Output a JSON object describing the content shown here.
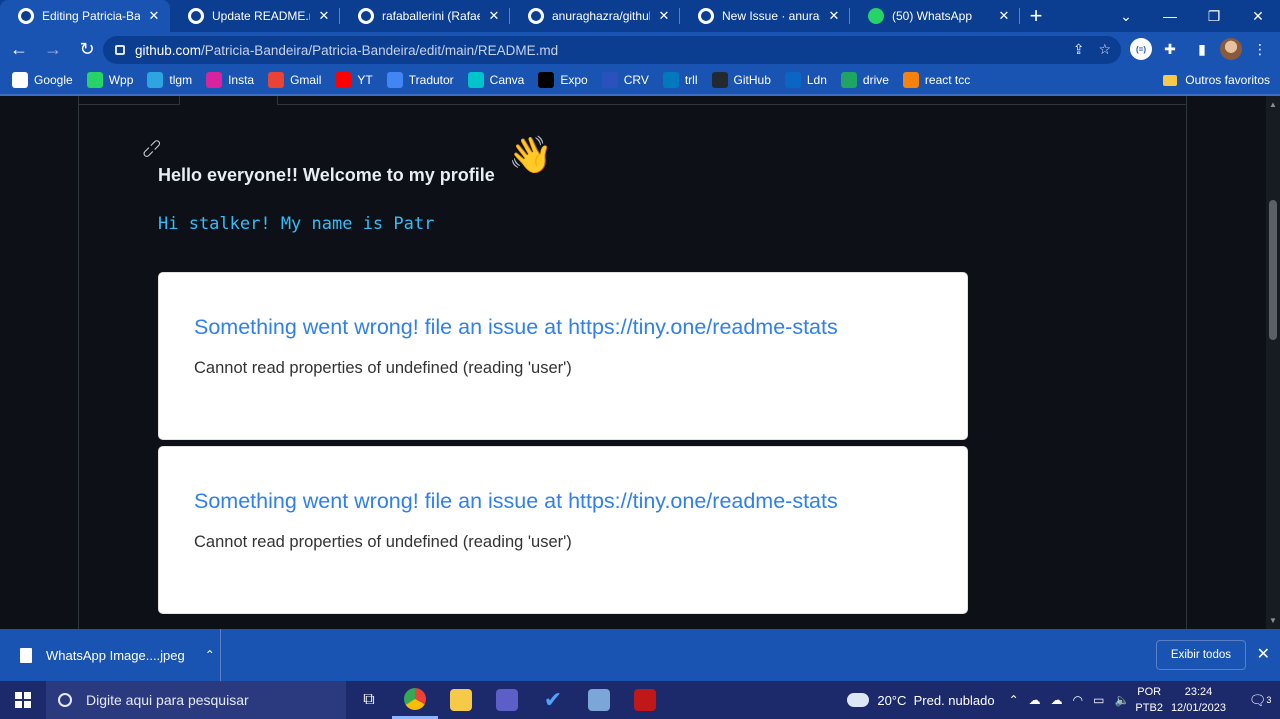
{
  "tabs": [
    {
      "title": "Editing Patricia-Bande",
      "favicon": "github-icon",
      "active": true
    },
    {
      "title": "Update README.md ·",
      "favicon": "github-icon",
      "active": false
    },
    {
      "title": "rafaballerini (Rafaella",
      "favicon": "github-icon",
      "active": false
    },
    {
      "title": "anuraghazra/github-re",
      "favicon": "github-icon",
      "active": false
    },
    {
      "title": "New Issue · anuraghaz",
      "favicon": "github-icon",
      "active": false
    },
    {
      "title": "(50) WhatsApp",
      "favicon": "whatsapp-icon",
      "active": false
    }
  ],
  "omnibox": {
    "host": "github.com",
    "path": "/Patricia-Bandeira/Patricia-Bandeira/edit/main/README.md"
  },
  "bookmarks": [
    {
      "label": "Google",
      "icon": "google-icon",
      "color": "#ffffff"
    },
    {
      "label": "Wpp",
      "icon": "whatsapp-icon",
      "color": "#25d366"
    },
    {
      "label": "tlgm",
      "icon": "telegram-icon",
      "color": "#2ca5e0"
    },
    {
      "label": "Insta",
      "icon": "instagram-icon",
      "color": "#d6249f"
    },
    {
      "label": "Gmail",
      "icon": "gmail-icon",
      "color": "#ea4335"
    },
    {
      "label": "YT",
      "icon": "youtube-icon",
      "color": "#ff0000"
    },
    {
      "label": "Tradutor",
      "icon": "translate-icon",
      "color": "#4285f4"
    },
    {
      "label": "Canva",
      "icon": "canva-icon",
      "color": "#00c4cc"
    },
    {
      "label": "Expo",
      "icon": "expo-icon",
      "color": "#000000"
    },
    {
      "label": "CRV",
      "icon": "crv-icon",
      "color": "#2a52be"
    },
    {
      "label": "trll",
      "icon": "trello-icon",
      "color": "#0079bf"
    },
    {
      "label": "GitHub",
      "icon": "github-icon",
      "color": "#24292f"
    },
    {
      "label": "Ldn",
      "icon": "linkedin-icon",
      "color": "#0a66c2"
    },
    {
      "label": "drive",
      "icon": "drive-icon",
      "color": "#1fa463"
    },
    {
      "label": "react tcc",
      "icon": "firebase-icon",
      "color": "#f5820d"
    }
  ],
  "bookmarks_other": "Outros favoritos",
  "readme": {
    "heading": "Hello everyone!! Welcome to my profile",
    "wave_emoji": "👋",
    "typing_text": "Hi stalker! My name is Patr",
    "cards": [
      {
        "title": "Something went wrong! file an issue at https://tiny.one/readme-stats",
        "message": "Cannot read properties of undefined (reading 'user')"
      },
      {
        "title": "Something went wrong! file an issue at https://tiny.one/readme-stats",
        "message": "Cannot read properties of undefined (reading 'user')"
      }
    ]
  },
  "download": {
    "filename": "WhatsApp Image....jpeg",
    "show_all": "Exibir todos"
  },
  "taskbar": {
    "search_placeholder": "Digite aqui para pesquisar",
    "weather_temp": "20°C",
    "weather_desc": "Pred. nublado",
    "lang_top": "POR",
    "lang_bottom": "PTB2",
    "time": "23:24",
    "date": "12/01/2023",
    "notif_count": "3"
  },
  "colors": {
    "chrome_dark": "#0b3d91",
    "chrome": "#1a54b3",
    "page_bg": "#0d1117",
    "error_title": "#2f80ed",
    "typing": "#36bcf7"
  }
}
